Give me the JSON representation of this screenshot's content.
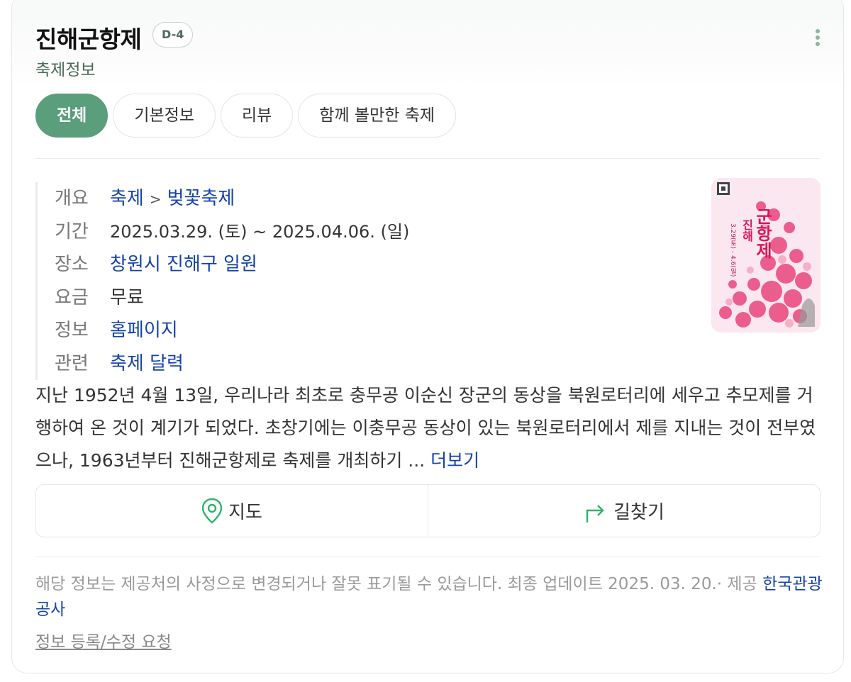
{
  "header": {
    "title": "진해군항제",
    "dday": "D-4",
    "subtitle": "축제정보"
  },
  "tabs": [
    {
      "label": "전체",
      "active": true
    },
    {
      "label": "기본정보",
      "active": false
    },
    {
      "label": "리뷰",
      "active": false
    },
    {
      "label": "함께 볼만한 축제",
      "active": false
    }
  ],
  "info": {
    "overview": {
      "label": "개요",
      "category": "축제",
      "separator": ">",
      "subcategory": "벚꽃축제"
    },
    "period": {
      "label": "기간",
      "value": "2025.03.29. (토) ~  2025.04.06. (일)"
    },
    "place": {
      "label": "장소",
      "value": "창원시 진해구 일원"
    },
    "fee": {
      "label": "요금",
      "value": "무료"
    },
    "info_link": {
      "label": "정보",
      "value": "홈페이지"
    },
    "related": {
      "label": "관련",
      "value": "축제 달력"
    }
  },
  "poster": {
    "title_lines": [
      "진해",
      "군항제"
    ],
    "dates": "3.29(토) - 4.6(일)",
    "colors": {
      "bg": "#fbe7ef",
      "blossom": "#e9467c",
      "title": "#d6185b"
    }
  },
  "description": {
    "text": "지난 1952년 4월 13일, 우리나라 최초로 충무공 이순신 장군의 동상을 북원로터리에 세우고 추모제를 거행하여 온 것이 계기가 되었다. 초창기에는 이충무공 동상이 있는 북원로터리에서 제를 지내는 것이 전부였으나, 1963년부터 진해군항제로 축제를 개최하기 ...",
    "more_label": "더보기"
  },
  "actions": {
    "map_label": "지도",
    "directions_label": "길찾기"
  },
  "footer": {
    "notice": "해당 정보는 제공처의 사정으로 변경되거나 잘못 표기될 수 있습니다. 최종 업데이트 2025. 03. 20.· 제공",
    "provider": "한국관광공사",
    "request_label": "정보 등록/수정 요청"
  },
  "colors": {
    "accent": "#5a9e7c",
    "link": "#1543a8",
    "dday_text": "#4d6a5c"
  }
}
